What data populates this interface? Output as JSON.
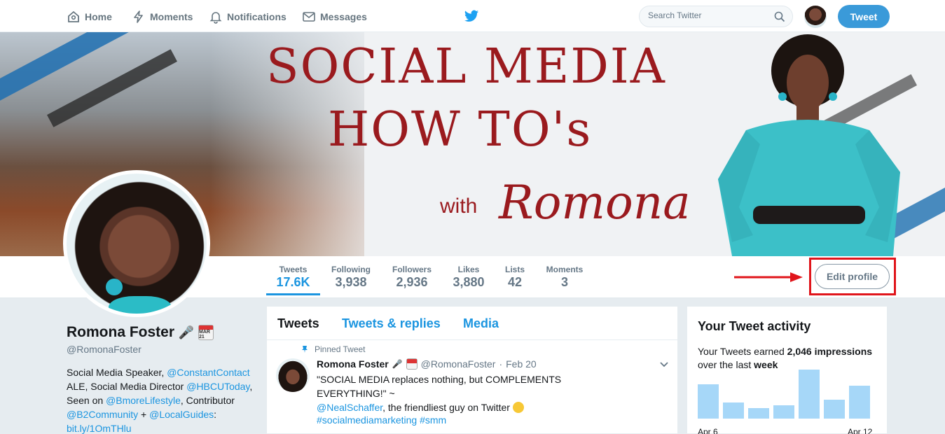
{
  "nav": {
    "home": "Home",
    "moments": "Moments",
    "notifications": "Notifications",
    "messages": "Messages",
    "search_placeholder": "Search Twitter",
    "tweet_button": "Tweet"
  },
  "banner": {
    "line1": "SOCIAL MEDIA",
    "line2": "HOW TO's",
    "with": "with",
    "signature": "Romona"
  },
  "stats": [
    {
      "label": "Tweets",
      "value": "17.6K"
    },
    {
      "label": "Following",
      "value": "3,938"
    },
    {
      "label": "Followers",
      "value": "2,936"
    },
    {
      "label": "Likes",
      "value": "3,880"
    },
    {
      "label": "Lists",
      "value": "42"
    },
    {
      "label": "Moments",
      "value": "3"
    }
  ],
  "edit_profile": "Edit profile",
  "profile": {
    "name": "Romona Foster",
    "calendar_emoji": "MAR 21",
    "handle": "@RomonaFoster",
    "bio": {
      "t1": "Social Media Speaker, ",
      "l1": "@ConstantContact",
      "t2": "ALE, Social Media Director ",
      "l2": "@HBCUToday",
      "t3": ",",
      "t4": "Seen on ",
      "l3": "@BmoreLifestyle",
      "t5": ", Contributor",
      "l4": "@B2Community",
      "t6": " + ",
      "l5": "@LocalGuides",
      "t7": ":",
      "l6": "bit.ly/1OmTHlu"
    }
  },
  "timeline": {
    "tabs": [
      "Tweets",
      "Tweets & replies",
      "Media"
    ],
    "pinned_label": "Pinned Tweet",
    "tweet": {
      "name": "Romona Foster",
      "handle": "@RomonaFoster",
      "date": "Feb 20",
      "text1": "\"SOCIAL MEDIA replaces nothing, but COMPLEMENTS EVERYTHING!\" ~",
      "mention": "@NealSchaffer",
      "text2": ", the friendliest guy on Twitter",
      "tags": "#socialmediamarketing #smm"
    }
  },
  "activity": {
    "title": "Your Tweet activity",
    "text1": "Your Tweets earned ",
    "impressions": "2,046 impressions",
    "text2": "over the last ",
    "period": "week",
    "start_label": "Apr 6",
    "end_label": "Apr 12",
    "bars": [
      0.7,
      0.33,
      0.22,
      0.27,
      1.0,
      0.38,
      0.67
    ]
  }
}
